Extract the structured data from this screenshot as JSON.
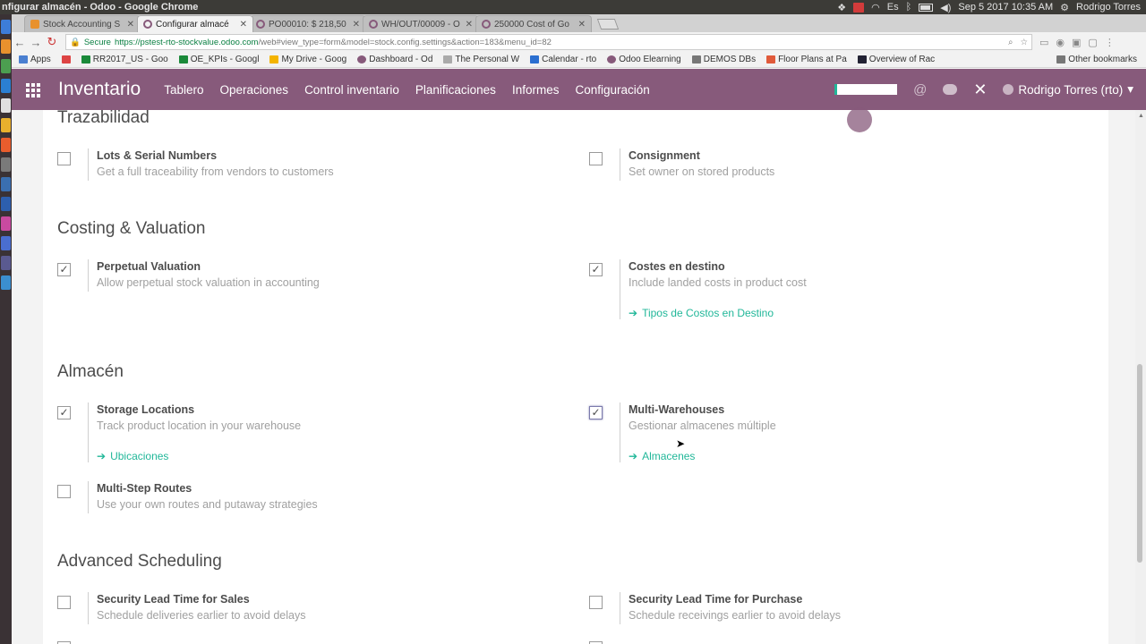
{
  "os": {
    "window_title": "nfigurar almacén - Odoo - Google Chrome",
    "datetime": "Sep 5 2017 10:35 AM",
    "user": "Rodrigo Torres"
  },
  "browser": {
    "tabs": [
      {
        "label": "Stock Accounting S",
        "active": false
      },
      {
        "label": "Configurar almacé",
        "active": true
      },
      {
        "label": "PO00010: $ 218,50",
        "active": false
      },
      {
        "label": "WH/OUT/00009 - O",
        "active": false
      },
      {
        "label": "250000 Cost of Go",
        "active": false
      }
    ],
    "secure_label": "Secure",
    "url_main": "https://pstest-rto-stockvalue.odoo.com",
    "url_rest": "/web#view_type=form&model=stock.config.settings&action=183&menu_id=82",
    "bookmarks": [
      "Apps",
      "RR2017_US - Goo",
      "OE_KPIs - Googl",
      "My Drive - Goog",
      "Dashboard - Od",
      "The Personal W",
      "Calendar - rto",
      "Odoo Elearning",
      "DEMOS DBs",
      "Floor Plans at Pa",
      "Overview of Rac"
    ],
    "other_bookmarks": "Other bookmarks"
  },
  "odoo": {
    "app_title": "Inventario",
    "menu": [
      "Tablero",
      "Operaciones",
      "Control inventario",
      "Planificaciones",
      "Informes",
      "Configuración"
    ],
    "user_name": "Rodrigo Torres (rto)",
    "progress_fraction": 0.05
  },
  "sections": {
    "trazabilidad": "Trazabilidad",
    "costing": "Costing & Valuation",
    "almacen": "Almacén",
    "scheduling": "Advanced Scheduling"
  },
  "settings": {
    "lots": {
      "name": "Lots & Serial Numbers",
      "desc": "Get a full traceability from vendors to customers",
      "checked": false
    },
    "consignment": {
      "name": "Consignment",
      "desc": "Set owner on stored products",
      "checked": false
    },
    "perpetual": {
      "name": "Perpetual Valuation",
      "desc": "Allow perpetual stock valuation in accounting",
      "checked": true
    },
    "landed": {
      "name": "Costes en destino",
      "desc": "Include landed costs in product cost",
      "checked": true,
      "link": "Tipos de Costos en Destino"
    },
    "storage": {
      "name": "Storage Locations",
      "desc": "Track product location in your warehouse",
      "checked": true,
      "link": "Ubicaciones"
    },
    "multiwh": {
      "name": "Multi-Warehouses",
      "desc": "Gestionar almacenes múltiple",
      "checked": true,
      "link": "Almacenes"
    },
    "multistep": {
      "name": "Multi-Step Routes",
      "desc": "Use your own routes and putaway strategies",
      "checked": false
    },
    "lead_sales": {
      "name": "Security Lead Time for Sales",
      "desc": "Schedule deliveries earlier to avoid delays",
      "checked": false
    },
    "lead_purchase": {
      "name": "Security Lead Time for Purchase",
      "desc": "Schedule receivings earlier to avoid delays",
      "checked": false
    }
  },
  "checkmark_glyph": "✓",
  "colors": {
    "odoo_purple": "#875a7b",
    "link_teal": "#21b799"
  }
}
